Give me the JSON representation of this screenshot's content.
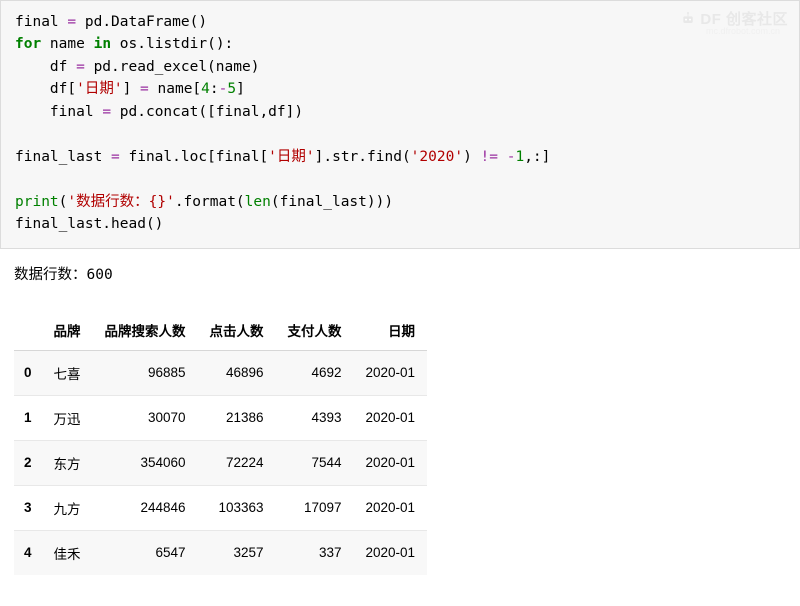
{
  "watermark": {
    "brand": "DF 创客社区",
    "url": "mc.dfrobot.com.cn"
  },
  "code": {
    "l1_a": "final ",
    "l1_op": "=",
    "l1_b": " pd.DataFrame()",
    "l2_for": "for",
    "l2_a": " name ",
    "l2_in": "in",
    "l2_b": " os.listdir():",
    "l3_a": "    df ",
    "l3_op": "=",
    "l3_b": " pd.read_excel(name)",
    "l4_a": "    df[",
    "l4_s": "'日期'",
    "l4_b": "] ",
    "l4_op": "=",
    "l4_c": " name[",
    "l4_n1": "4",
    "l4_d": ":",
    "l4_neg": "-",
    "l4_n2": "5",
    "l4_e": "]",
    "l5_a": "    final ",
    "l5_op": "=",
    "l5_b": " pd.concat([final,df])",
    "l7_a": "final_last ",
    "l7_op": "=",
    "l7_b": " final.loc[final[",
    "l7_s1": "'日期'",
    "l7_c": "].str.find(",
    "l7_s2": "'2020'",
    "l7_d": ") ",
    "l7_ne": "!=",
    "l7_e": " ",
    "l7_neg": "-",
    "l7_n": "1",
    "l7_f": ",:]",
    "l9_p": "print",
    "l9_a": "(",
    "l9_s": "'数据行数：{}'",
    "l9_b": ".format(",
    "l9_len": "len",
    "l9_c": "(final_last)))",
    "l10": "final_last.head()"
  },
  "output_line": "数据行数：600",
  "table": {
    "headers": [
      "品牌",
      "品牌搜索人数",
      "点击人数",
      "支付人数",
      "日期"
    ],
    "rows": [
      {
        "idx": "0",
        "brand": "七喜",
        "search": "96885",
        "click": "46896",
        "pay": "4692",
        "date": "2020-01"
      },
      {
        "idx": "1",
        "brand": "万迅",
        "search": "30070",
        "click": "21386",
        "pay": "4393",
        "date": "2020-01"
      },
      {
        "idx": "2",
        "brand": "东方",
        "search": "354060",
        "click": "72224",
        "pay": "7544",
        "date": "2020-01"
      },
      {
        "idx": "3",
        "brand": "九方",
        "search": "244846",
        "click": "103363",
        "pay": "17097",
        "date": "2020-01"
      },
      {
        "idx": "4",
        "brand": "佳禾",
        "search": "6547",
        "click": "3257",
        "pay": "337",
        "date": "2020-01"
      }
    ]
  }
}
